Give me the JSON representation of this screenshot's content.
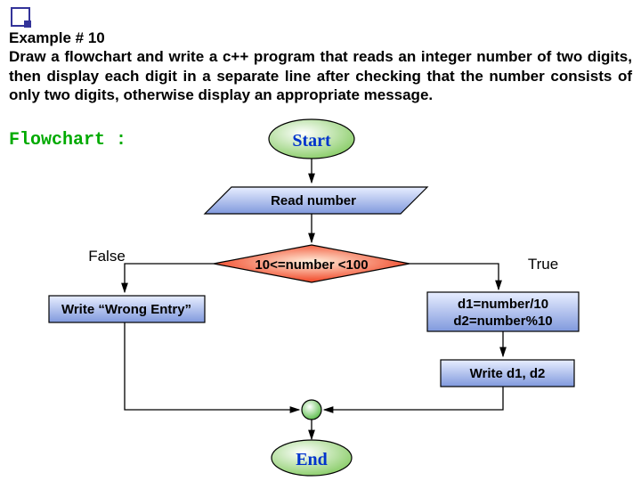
{
  "title_line": "Example # 10",
  "prompt": "Draw a flowchart and write a c++ program that reads an integer number of two digits, then display each digit in a separate line after checking that the number consists of only two digits, otherwise display an appropriate message.",
  "flowchart_label": "Flowchart :",
  "nodes": {
    "start": "Start",
    "read": "Read number",
    "decision": "10<=number <100",
    "false_label": "False",
    "true_label": "True",
    "wrong": "Write “Wrong Entry”",
    "calc_line1": "d1=number/10",
    "calc_line2": "d2=number%10",
    "write_d": "Write d1, d2",
    "end": "End"
  }
}
